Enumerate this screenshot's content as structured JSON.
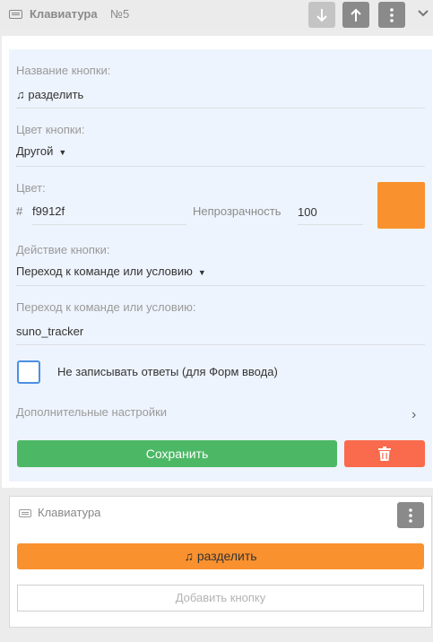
{
  "header": {
    "title": "Клавиатура",
    "number": "№5",
    "icons": {
      "keyboard": "keyboard-icon",
      "move_down": "arrow-down-icon",
      "move_up": "arrow-up-icon",
      "menu": "more-vertical-icon",
      "collapse": "chevron-down-icon"
    }
  },
  "editor": {
    "name_label": "Название кнопки:",
    "name_value": "♫ разделить",
    "color_label": "Цвет кнопки:",
    "color_value": "Другой",
    "hex_label": "Цвет:",
    "hash": "#",
    "hex_value": "f9912f",
    "opacity_label": "Непрозрачность",
    "opacity_value": "100",
    "swatch_color": "#f9912f",
    "action_label": "Действие кнопки:",
    "action_value": "Переход к команде или условию",
    "goto_label": "Переход к команде или условию:",
    "goto_value": "suno_tracker",
    "checkbox_label": "Не записывать ответы (для Форм ввода)",
    "advanced_label": "Дополнительные настройки",
    "save_label": "Сохранить",
    "colors": {
      "save": "#4cb865",
      "delete": "#fa6a4d",
      "panel_bg": "#eef4fd",
      "checkbox_border": "#4a90e2"
    }
  },
  "preview": {
    "title": "Клавиатура",
    "button_label": "♫ разделить",
    "add_button_label": "Добавить кнопку"
  }
}
